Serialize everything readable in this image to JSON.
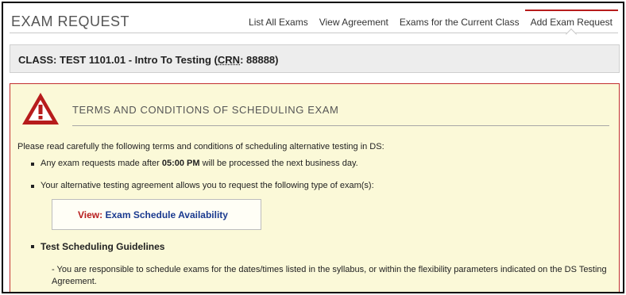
{
  "header": {
    "title": "EXAM REQUEST",
    "tabs": [
      {
        "label": "List All Exams"
      },
      {
        "label": "View Agreement"
      },
      {
        "label": "Exams for the Current Class"
      },
      {
        "label": "Add Exam Request"
      }
    ],
    "active_tab": "Add Exam Request"
  },
  "class_bar": {
    "prefix": "CLASS: TEST 1101.01 - Intro To Testing (",
    "crn_label": "CRN",
    "suffix": ": 88888)"
  },
  "terms": {
    "icon": "warning-triangle-icon",
    "title": "TERMS AND CONDITIONS OF SCHEDULING EXAM",
    "intro": "Please read carefully the following terms and conditions of scheduling alternative testing in DS:",
    "bullet1": {
      "before": "Any exam requests made after ",
      "time": "05:00 PM",
      "after": " will be processed the next business day."
    },
    "bullet2": "Your alternative testing agreement allows you to request the following type of exam(s):",
    "view_label": "View:",
    "view_link": "Exam Schedule Availability",
    "guidelines_title": "Test Scheduling Guidelines",
    "guidelines_text": "- You are responsible to schedule exams for the dates/times listed in the syllabus, or within the flexibility parameters indicated on the DS Testing Agreement."
  },
  "colors": {
    "accent_red": "#b71c1c",
    "terms_bg": "#fbf9d8",
    "link_blue": "#1a3a8f",
    "class_bar_bg": "#ededed"
  }
}
